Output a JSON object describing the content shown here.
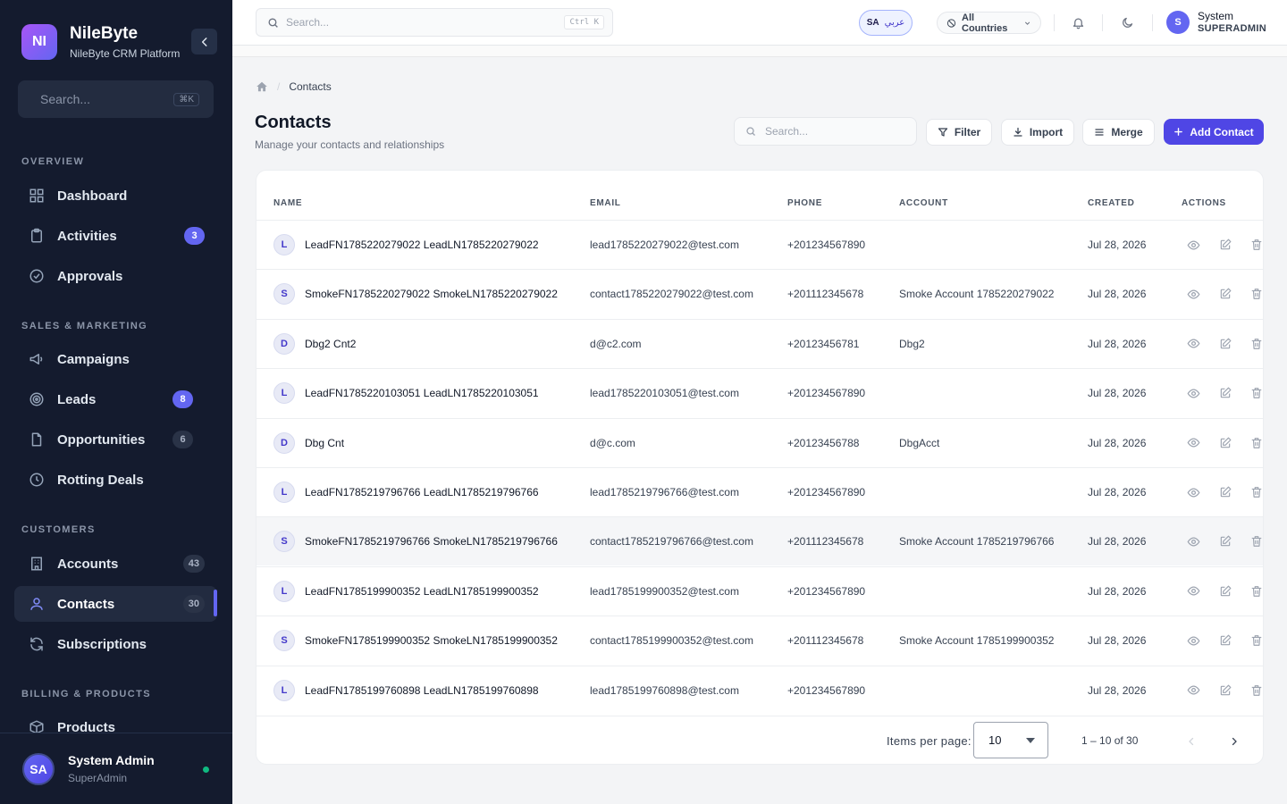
{
  "brand": {
    "logo": "NI",
    "name": "NileByte",
    "subtitle": "NileByte CRM Platform"
  },
  "sidebar": {
    "search": {
      "placeholder": "Search...",
      "shortcut": "⌘K"
    },
    "sections": {
      "overview": "OVERVIEW",
      "sales": "SALES & MARKETING",
      "customers": "CUSTOMERS",
      "billing": "BILLING & PRODUCTS"
    },
    "items": {
      "dashboard": {
        "label": "Dashboard",
        "icon": "grid-icon"
      },
      "activities": {
        "label": "Activities",
        "badge": "3",
        "icon": "clipboard-icon"
      },
      "approvals": {
        "label": "Approvals",
        "icon": "check-circle-icon"
      },
      "campaigns": {
        "label": "Campaigns",
        "icon": "megaphone-icon"
      },
      "leads": {
        "label": "Leads",
        "badge": "8",
        "icon": "target-icon"
      },
      "opportunities": {
        "label": "Opportunities",
        "badge": "6",
        "icon": "document-icon"
      },
      "rotting": {
        "label": "Rotting Deals",
        "icon": "clock-icon"
      },
      "accounts": {
        "label": "Accounts",
        "badge": "43",
        "icon": "building-icon"
      },
      "contacts": {
        "label": "Contacts",
        "badge": "30",
        "icon": "user-icon",
        "active": true
      },
      "subscriptions": {
        "label": "Subscriptions",
        "icon": "refresh-icon"
      },
      "products": {
        "label": "Products",
        "icon": "box-icon"
      }
    },
    "user": {
      "initials": "SA",
      "name": "System Admin",
      "role": "SuperAdmin",
      "status": "online"
    }
  },
  "topbar": {
    "search": {
      "placeholder": "Search...",
      "shortcut": "Ctrl K"
    },
    "language": {
      "code": "SA",
      "label": "عربي"
    },
    "country": "All Countries",
    "user": {
      "initial": "S",
      "name": "System",
      "role": "SUPERADMIN"
    }
  },
  "breadcrumb": {
    "current": "Contacts"
  },
  "page": {
    "title": "Contacts",
    "subtitle": "Manage your contacts and relationships"
  },
  "toolbar": {
    "search_placeholder": "Search...",
    "filter": "Filter",
    "import": "Import",
    "merge": "Merge",
    "add": "Add Contact"
  },
  "table": {
    "columns": {
      "name": "NAME",
      "email": "EMAIL",
      "phone": "PHONE",
      "account": "ACCOUNT",
      "created": "CREATED",
      "actions": "ACTIONS"
    },
    "rows": [
      {
        "initial": "L",
        "name": "LeadFN1785220279022 LeadLN1785220279022",
        "email": "lead1785220279022@test.com",
        "phone": "+201234567890",
        "account": "",
        "created": "Jul 28, 2026"
      },
      {
        "initial": "S",
        "name": "SmokeFN1785220279022 SmokeLN1785220279022",
        "email": "contact1785220279022@test.com",
        "phone": "+201112345678",
        "account": "Smoke Account 1785220279022",
        "created": "Jul 28, 2026"
      },
      {
        "initial": "D",
        "name": "Dbg2 Cnt2",
        "email": "d@c2.com",
        "phone": "+20123456781",
        "account": "Dbg2",
        "created": "Jul 28, 2026"
      },
      {
        "initial": "L",
        "name": "LeadFN1785220103051 LeadLN1785220103051",
        "email": "lead1785220103051@test.com",
        "phone": "+201234567890",
        "account": "",
        "created": "Jul 28, 2026"
      },
      {
        "initial": "D",
        "name": "Dbg Cnt",
        "email": "d@c.com",
        "phone": "+20123456788",
        "account": "DbgAcct",
        "created": "Jul 28, 2026"
      },
      {
        "initial": "L",
        "name": "LeadFN1785219796766 LeadLN1785219796766",
        "email": "lead1785219796766@test.com",
        "phone": "+201234567890",
        "account": "",
        "created": "Jul 28, 2026"
      },
      {
        "initial": "S",
        "name": "SmokeFN1785219796766 SmokeLN1785219796766",
        "email": "contact1785219796766@test.com",
        "phone": "+201112345678",
        "account": "Smoke Account 1785219796766",
        "created": "Jul 28, 2026",
        "highlighted": true
      },
      {
        "initial": "L",
        "name": "LeadFN1785199900352 LeadLN1785199900352",
        "email": "lead1785199900352@test.com",
        "phone": "+201234567890",
        "account": "",
        "created": "Jul 28, 2026"
      },
      {
        "initial": "S",
        "name": "SmokeFN1785199900352 SmokeLN1785199900352",
        "email": "contact1785199900352@test.com",
        "phone": "+201112345678",
        "account": "Smoke Account 1785199900352",
        "created": "Jul 28, 2026"
      },
      {
        "initial": "L",
        "name": "LeadFN1785199760898 LeadLN1785199760898",
        "email": "lead1785199760898@test.com",
        "phone": "+201234567890",
        "account": "",
        "created": "Jul 28, 2026"
      }
    ]
  },
  "pagination": {
    "items_per_page_label": "Items per page:",
    "items_per_page": "10",
    "range": "1 – 10 of 30"
  },
  "colors": {
    "accent": "#4f46e5",
    "sidebar_bg": "#141b2e",
    "online": "#10b981"
  }
}
